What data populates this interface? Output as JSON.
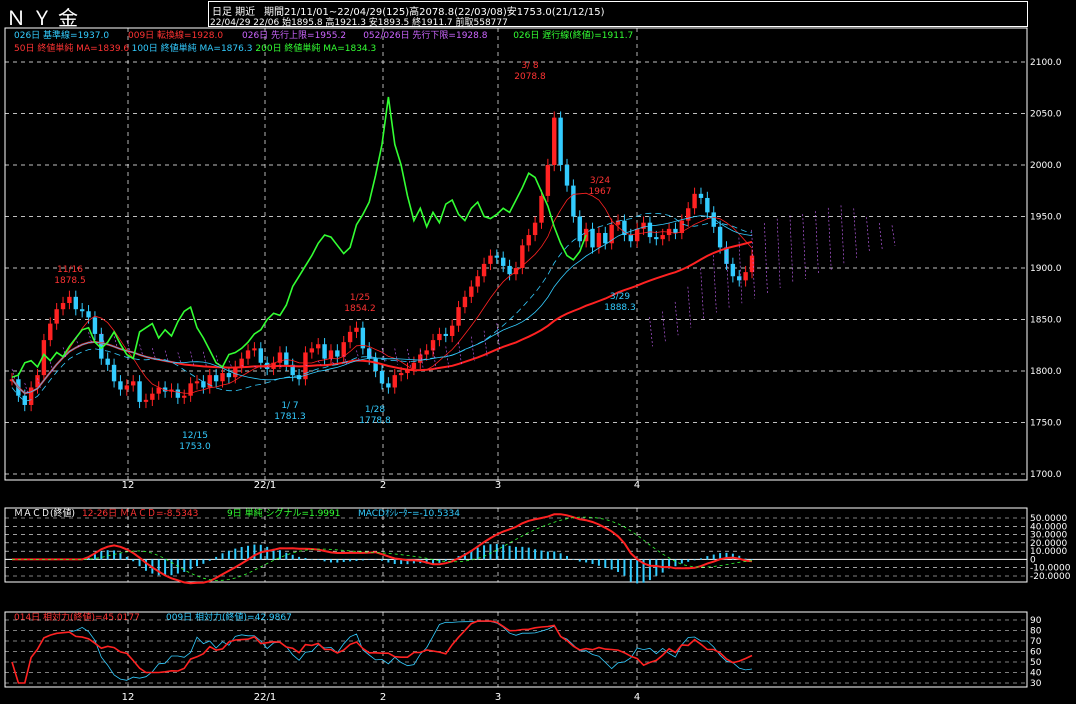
{
  "header": {
    "title": "ＮＹ金",
    "period_label": "日足 期近",
    "period_info": "期間21/11/01~22/04/29(125)高2078.8(22/03/08)安1753.0(21/12/15)",
    "bar_info": "22/04/29 22/06 始1895.8 高1921.3 安1893.5 終1911.7 前取558777"
  },
  "legend": {
    "row1": [
      {
        "text": "026日 基準線=1937.0",
        "color": "#33ccff"
      },
      {
        "text": "009日 転換線=1928.0",
        "color": "#ff3333"
      },
      {
        "text": "026日 先行上限=1955.2",
        "color": "#cc66ff"
      },
      {
        "text": "052/026日 先行下限=1928.8",
        "color": "#cc66ff"
      },
      {
        "text": "026日 遅行線(終値)=1911.7",
        "color": "#33ff33"
      }
    ],
    "row2": [
      {
        "text": "50日 終値単純 MA=1839.6",
        "color": "#ff3333"
      },
      {
        "text": "100日 終値単純 MA=1876.3",
        "color": "#33ccff"
      },
      {
        "text": "200日 終値単純 MA=1834.3",
        "color": "#33ff33"
      }
    ]
  },
  "price_axis": [
    "2100.0",
    "2050.0",
    "2000.0",
    "1950.0",
    "1900.0",
    "1850.0",
    "1800.0",
    "1750.0",
    "1700.0"
  ],
  "month_labels": [
    "12",
    "22/1",
    "2",
    "3",
    "4"
  ],
  "annotations": [
    {
      "lines": [
        "11/16",
        "1878.5"
      ],
      "color": "#ff3333"
    },
    {
      "lines": [
        "12/15",
        "1753.0"
      ],
      "color": "#33ccff"
    },
    {
      "lines": [
        "1/ 7",
        "1781.3"
      ],
      "color": "#33ccff"
    },
    {
      "lines": [
        "1/25",
        "1854.2"
      ],
      "color": "#ff3333"
    },
    {
      "lines": [
        "1/28",
        "1778.8"
      ],
      "color": "#33ccff"
    },
    {
      "lines": [
        "3/ 8",
        "2078.8"
      ],
      "color": "#ff3333"
    },
    {
      "lines": [
        "3/24",
        "1967"
      ],
      "color": "#ff3333"
    },
    {
      "lines": [
        "3/29",
        "1888.3"
      ],
      "color": "#33ccff"
    }
  ],
  "macd": {
    "legend": [
      {
        "text": "ＭＡＣＤ(終値)",
        "color": "#ffffff"
      },
      {
        "text": "12-26日 ＭＡＣＤ=-8.5343",
        "color": "#ff3333"
      },
      {
        "text": "9日 単純 シグナル=1.9991",
        "color": "#33ff33"
      },
      {
        "text": "MACDｵｼﾚｰﾀｰ=-10.5334",
        "color": "#33ccff"
      }
    ],
    "axis": [
      "50.0000",
      "40.0000",
      "30.0000",
      "20.0000",
      "10.0000",
      "0",
      "-10.0000",
      "-20.0000"
    ]
  },
  "rsi": {
    "legend": [
      {
        "text": "014日 相対力(終値)=45.0177",
        "color": "#ff3333"
      },
      {
        "text": "009日 相対力(終値)=42.9867",
        "color": "#33ccff"
      }
    ],
    "axis": [
      "90",
      "80",
      "70",
      "60",
      "50",
      "40",
      "30"
    ]
  },
  "colors": {
    "up": "#ff2222",
    "down": "#33ccff",
    "grid": "#ffffff",
    "ma50": "#ff2222",
    "ma100": "#33ccff",
    "ma200": "#33ff33",
    "lag": "#33ff33",
    "kumo": "#cc66ff"
  },
  "chart_data": {
    "type": "line",
    "title": "ＮＹ金",
    "ylim": [
      1700,
      2100
    ],
    "x_months": [
      "12",
      "22/1",
      "2",
      "3",
      "4"
    ],
    "close_series": {
      "points": [
        1792,
        1776,
        1767,
        1784,
        1796,
        1830,
        1846,
        1860,
        1866,
        1872,
        1860,
        1858,
        1852,
        1836,
        1812,
        1806,
        1790,
        1782,
        1786,
        1790,
        1770,
        1772,
        1778,
        1784,
        1780,
        1782,
        1774,
        1776,
        1788,
        1790,
        1784,
        1796,
        1790,
        1798,
        1794,
        1804,
        1812,
        1820,
        1822,
        1808,
        1802,
        1808,
        1818,
        1806,
        1796,
        1792,
        1818,
        1822,
        1826,
        1812,
        1820,
        1814,
        1828,
        1838,
        1842,
        1822,
        1812,
        1800,
        1788,
        1784,
        1796,
        1798,
        1802,
        1808,
        1816,
        1820,
        1830,
        1836,
        1834,
        1844,
        1862,
        1872,
        1882,
        1892,
        1904,
        1912,
        1910,
        1902,
        1894,
        1900,
        1922,
        1932,
        1944,
        1970,
        2000,
        2046,
        2000,
        1980,
        1950,
        1926,
        1938,
        1920,
        1934,
        1924,
        1942,
        1946,
        1932,
        1926,
        1938,
        1944,
        1930,
        1928,
        1932,
        1938,
        1934,
        1946,
        1958,
        1972,
        1968,
        1954,
        1940,
        1920,
        1904,
        1892,
        1888,
        1896,
        1912
      ]
    },
    "ma50_last": 1839.6,
    "ma100_last": 1876.3,
    "ma200_last": 1834.3,
    "macd_range": [
      -20,
      50
    ],
    "rsi_range": [
      30,
      90
    ]
  }
}
